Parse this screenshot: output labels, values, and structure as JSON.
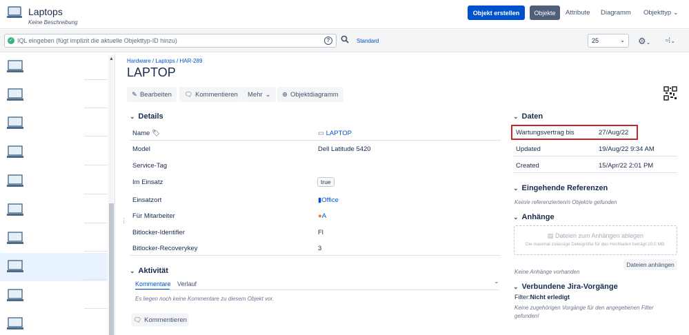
{
  "header": {
    "title": "Laptops",
    "subtitle": "Keine Beschreibung",
    "create_button": "Objekt erstellen",
    "nav": [
      "Objekte",
      "Attribute",
      "Diagramm",
      "Objekttyp"
    ],
    "nav_selected": "Objekte"
  },
  "toolbar": {
    "search_placeholder": "IQL eingeben (fügt implizit die aktuelle Objekttyp-ID hinzu)",
    "standard_link": "Standard",
    "page_size": "25"
  },
  "object": {
    "breadcrumb": "Hardware / Laptops / HAR-289",
    "title": "LAPTOP",
    "actions": {
      "edit": "Bearbeiten",
      "comment": "Kommentieren",
      "more": "Mehr",
      "diagram": "Objektdiagramm"
    }
  },
  "details": {
    "heading": "Details",
    "rows": [
      {
        "label": "Name",
        "value": "LAPTOP"
      },
      {
        "label": "Model",
        "value": "Dell Latitude 5420"
      },
      {
        "label": "Service-Tag",
        "value": ""
      },
      {
        "label": "Im Einsatz",
        "value": "true"
      },
      {
        "label": "Einsatzort",
        "value": "Office"
      },
      {
        "label": "Für Mitarbeiter",
        "value": "A"
      },
      {
        "label": "Bitlocker-Identifier",
        "value": "Fl"
      },
      {
        "label": "Bitlocker-Recoverykey",
        "value": "3"
      }
    ]
  },
  "activity": {
    "heading": "Aktivität",
    "tab_comments": "Kommentare",
    "tab_history": "Verlauf",
    "empty_text": "Es liegen noch keine Kommentare zu diesem Objekt vor.",
    "comment_button": "Kommentieren"
  },
  "dates": {
    "heading": "Daten",
    "rows": [
      {
        "label": "Wartungsvertrag bis",
        "value": "27/Aug/22"
      },
      {
        "label": "Updated",
        "value": "19/Aug/22 9:34 AM"
      },
      {
        "label": "Created",
        "value": "15/Apr/22 2:01 PM"
      }
    ]
  },
  "incoming": {
    "heading": "Eingehende Referenzen",
    "empty_text": "Kein/e referenzierten/n Objekt/e gefunden"
  },
  "attachments": {
    "heading": "Anhänge",
    "drop_text": "Dateien zum Anhängen ablegen",
    "drop_hint": "Die maximal zulässige Dateigröße für das Hochladen beträgt 20,0 MB.",
    "attach_button": "Dateien anhängen",
    "empty_text": "Keine Anhänge vorhanden"
  },
  "jira": {
    "heading": "Verbundene Jira-Vorgänge",
    "filter_label": "Filter:",
    "filter_value": "Nicht erledigt",
    "empty_text_1": "Keine zugehörigen Vorgänge für den angegebenen Filter",
    "empty_text_2": "gefunden!"
  },
  "colors": {
    "primary": "#0052cc",
    "highlight_border": "#cc2229",
    "selected_nav": "#505f79"
  }
}
